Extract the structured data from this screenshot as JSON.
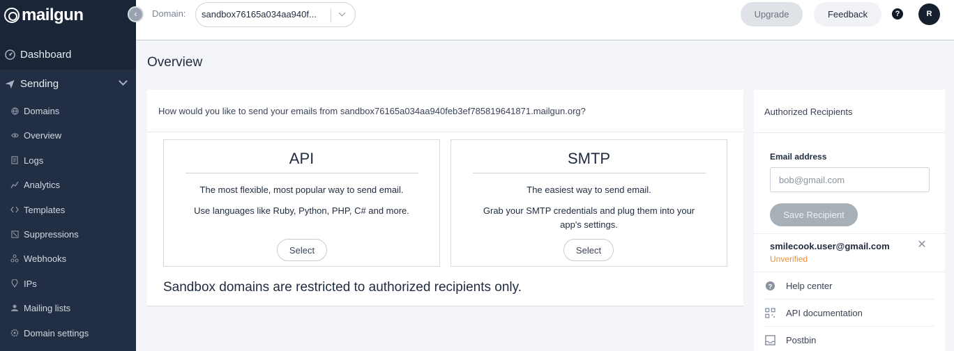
{
  "brand": {
    "name": "mailgun"
  },
  "sidebar": {
    "dashboard": "Dashboard",
    "sending": "Sending",
    "items": [
      {
        "label": "Domains",
        "icon": "globe-icon"
      },
      {
        "label": "Overview",
        "icon": "eye-icon"
      },
      {
        "label": "Logs",
        "icon": "document-icon"
      },
      {
        "label": "Analytics",
        "icon": "chart-icon"
      },
      {
        "label": "Templates",
        "icon": "code-icon"
      },
      {
        "label": "Suppressions",
        "icon": "block-icon"
      },
      {
        "label": "Webhooks",
        "icon": "webhook-icon"
      },
      {
        "label": "IPs",
        "icon": "pin-icon"
      },
      {
        "label": "Mailing lists",
        "icon": "people-icon"
      },
      {
        "label": "Domain settings",
        "icon": "settings-icon"
      }
    ]
  },
  "topbar": {
    "domain_label": "Domain:",
    "domain_value": "sandbox76165a034aa940f...",
    "upgrade": "Upgrade",
    "feedback": "Feedback",
    "help": "?",
    "avatar_initial": "R"
  },
  "main": {
    "title": "Overview",
    "question": "How would you like to send your emails from sandbox76165a034aa940feb3ef785819641871.mailgun.org?",
    "api": {
      "title": "API",
      "line1": "The most flexible, most popular way to send email.",
      "line2": "Use languages like Ruby, Python, PHP, C# and more.",
      "select": "Select"
    },
    "smtp": {
      "title": "SMTP",
      "line1": "The easiest way to send email.",
      "line2": "Grab your SMTP credentials and plug them into your app's settings.",
      "select": "Select"
    },
    "sandbox_note": "Sandbox domains are restricted to authorized recipients only."
  },
  "recipients": {
    "title": "Authorized Recipients",
    "email_label": "Email address",
    "email_placeholder": "bob@gmail.com",
    "save": "Save Recipient",
    "entries": [
      {
        "email": "smilecook.user@gmail.com",
        "status": "Unverified"
      }
    ],
    "links": [
      {
        "label": "Help center",
        "icon": "help-circle-icon"
      },
      {
        "label": "API documentation",
        "icon": "api-grid-icon"
      },
      {
        "label": "Postbin",
        "icon": "inbox-icon"
      }
    ]
  },
  "colors": {
    "sidebar": "#1b2538",
    "unverified": "#e8913b",
    "save_button": "#a7b0b7"
  }
}
